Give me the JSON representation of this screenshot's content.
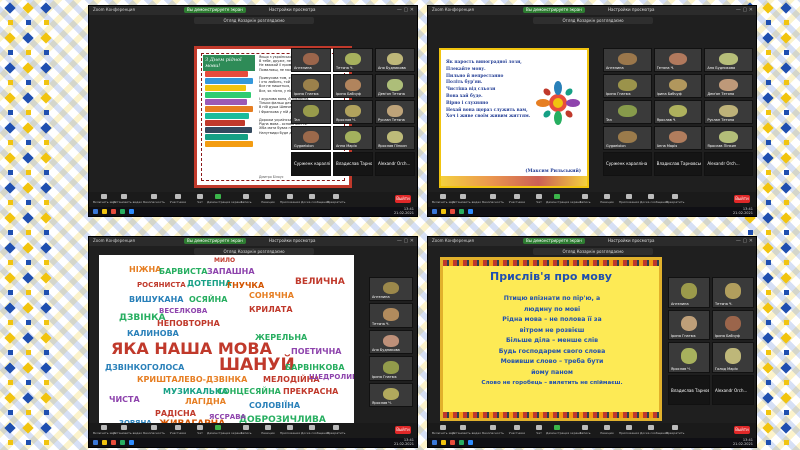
{
  "panels": [
    {
      "app_title": "Zoom Конференция",
      "meeting_pill": "Вы демонстрируете экран",
      "view_options": "Настройки просмотра",
      "share_bar": "Огляд Козаркін розглядаємо",
      "clock": {
        "time": "13:41",
        "date": "21.02.2021"
      },
      "gallery": [
        {
          "name": "Ангелина"
        },
        {
          "name": "Тетяна Ч."
        },
        {
          "name": "Аня Будникова"
        },
        {
          "name": "Ірина Гнатюк"
        },
        {
          "name": "Ірина Бабчуф"
        },
        {
          "name": "Дем'ян Тетяна"
        },
        {
          "name": "Tan"
        },
        {
          "name": "Ярослав Ч."
        },
        {
          "name": "Руслан Тетяна"
        },
        {
          "name": "Gygaelolon"
        },
        {
          "name": "Анна Марія"
        },
        {
          "name": "Ярослав Піпкин"
        },
        {
          "name": "Сурженк каралліна",
          "dark": true
        },
        {
          "name": "Владислав Тарновськ",
          "dark": true
        },
        {
          "name": "Alexandr Orch...",
          "dark": true
        }
      ],
      "toolbar": [
        "Включить звук",
        "Остановить видео",
        "Безопасность",
        "Участники",
        "Чат",
        "Демонстрация экрана",
        "Запись",
        "Реакции",
        "Приложения",
        "Доска сообщений",
        "Прекратить"
      ],
      "end_label": "Выйти",
      "slide": {
        "title": "З Днем рідної мови!",
        "poem": "Якщо з українською мовою\nВ тебе, друже, не все гаразд,\nНе вважай її примхою,\nПомиляєш, не молю все.\n\nПримусова тим, хто цурається,\nЇ хто любить, той легко вчить:\nВсе не пишеться, в ній вимовляється,\nВсе, як пісня, у ній звучить.\n\nІ журлива вона, й ніжнесна,\nТільки фальш для неї чужа.\nВ ній душа Шевченкова й Лесина,\nІ Франкова у ній душа.\n\nДорожи українською мовою,\nРідна мова - основа життя.\nХіба мати буває примусовою?\nНапутвиди буде дитя!",
        "author": "Дмитро Білоус"
      }
    },
    {
      "app_title": "Zoom Конференция",
      "meeting_pill": "Вы демонстрируете экран",
      "view_options": "Настройки просмотра",
      "share_bar": "Огляд Козаркін розглядаємо",
      "clock": {
        "time": "13:41",
        "date": "21.02.2021"
      },
      "gallery": [
        {
          "name": "Ангелина"
        },
        {
          "name": "Тетяна Ч."
        },
        {
          "name": "Аня Будникова"
        },
        {
          "name": "Ірина Гнатюк"
        },
        {
          "name": "Ірина Бабчуф"
        },
        {
          "name": "Дем'ян Тетяна"
        },
        {
          "name": "Tan"
        },
        {
          "name": "Ярослав Ч."
        },
        {
          "name": "Руслан Тетяна"
        },
        {
          "name": "Gygaelolon"
        },
        {
          "name": "Анна Марія"
        },
        {
          "name": "Ярослав Піпкин"
        },
        {
          "name": "Сурженк каралліна",
          "dark": true
        },
        {
          "name": "Владислав Тарновськ",
          "dark": true
        },
        {
          "name": "Alexandr Orch...",
          "dark": true
        }
      ],
      "toolbar": [
        "Включить звук",
        "Остановить видео",
        "Безопасность",
        "Участники",
        "Чат",
        "Демонстрация экрана",
        "Запись",
        "Реакции",
        "Приложения",
        "Доска сообщений",
        "Прекратить"
      ],
      "end_label": "Выйти",
      "slide": {
        "poem": "Як парость виноградної лози,\nПлекайте мову.\nПильно й непрестанно\nПоліть бур'ян.\nЧистіша від сльози\nВона хай буде.\nВірно і слухняно\nНехай вона щораз служить вам,\nХоч і живе своїм живим життям.",
        "author": "(Максим Рильський)"
      }
    },
    {
      "app_title": "Zoom Конференция",
      "meeting_pill": "Вы демонстрируете экран",
      "view_options": "Настройки просмотра",
      "share_bar": "Огляд Козаркін розглядаємо",
      "clock": {
        "time": "13:41",
        "date": "21.02.2021"
      },
      "gallery": [
        {
          "name": "Ангелина"
        },
        {
          "name": "Тетяна Ч."
        },
        {
          "name": "Аня Будникова"
        },
        {
          "name": "Ірина Гнатюк"
        },
        {
          "name": "Ярослав Ч."
        }
      ],
      "toolbar": [
        "Включить звук",
        "Остановить видео",
        "Безопасность",
        "Участники",
        "Чат",
        "Демонстрация экрана",
        "Запись",
        "Реакции",
        "Приложения",
        "Доска сообщений",
        "Прекратить"
      ],
      "end_label": "Выйти",
      "slide": {
        "words": [
          {
            "t": "МИЛО",
            "c": "#c0392b"
          },
          {
            "t": "НІЖНА",
            "c": "#e67e22"
          },
          {
            "t": "БАРВИСТА",
            "c": "#27ae60"
          },
          {
            "t": "ЗАПАШНА",
            "c": "#8e44ad"
          },
          {
            "t": "РОСЯНИСТА",
            "c": "#c0392b"
          },
          {
            "t": "ДОТЕПНА",
            "c": "#16a085"
          },
          {
            "t": "ГНУЧКА",
            "c": "#d35400"
          },
          {
            "t": "ВЕЛИЧНА",
            "c": "#c0392b"
          },
          {
            "t": "ВИШУКАНА",
            "c": "#2980b9"
          },
          {
            "t": "ОСЯЙНА",
            "c": "#27ae60"
          },
          {
            "t": "СОНЯЧНА",
            "c": "#e67e22"
          },
          {
            "t": "ВЕСЕЛКОВА",
            "c": "#8e44ad"
          },
          {
            "t": "КРИЛАТА",
            "c": "#c0392b"
          },
          {
            "t": "ДЗВІНКА",
            "c": "#27ae60"
          },
          {
            "t": "НЕПОВТОРНА",
            "c": "#c0392b"
          },
          {
            "t": "КАЛИНОВА",
            "c": "#2980b9"
          },
          {
            "t": "ЯКА НАША МОВА",
            "c": "#c0392b"
          },
          {
            "t": "ЖЕРЕЛЬНА",
            "c": "#27ae60"
          },
          {
            "t": "ШАНУЙ",
            "c": "#c0392b"
          },
          {
            "t": "ПОЕТИЧНА",
            "c": "#8e44ad"
          },
          {
            "t": "ДЗВІНКОГОЛОСА",
            "c": "#2980b9"
          },
          {
            "t": "БАРВІНКОВА",
            "c": "#27ae60"
          },
          {
            "t": "КРИШТАЛЕВО-ДЗВІНКА",
            "c": "#e67e22"
          },
          {
            "t": "МЕЛОДІЙНА",
            "c": "#c0392b"
          },
          {
            "t": "ЩЕДРОЛИВА",
            "c": "#8e44ad"
          },
          {
            "t": "МУЗИКАЛЬНА",
            "c": "#16a085"
          },
          {
            "t": "СОНЦЕСЯЙНА",
            "c": "#27ae60"
          },
          {
            "t": "ПРЕКРАСНА",
            "c": "#c0392b"
          },
          {
            "t": "СОЛОВІЇНА",
            "c": "#2980b9"
          },
          {
            "t": "ЛАГІДНА",
            "c": "#e67e22"
          },
          {
            "t": "ЧИСТА",
            "c": "#8e44ad"
          },
          {
            "t": "РАДІСНА",
            "c": "#c0392b"
          },
          {
            "t": "ЖИВАГАРНА",
            "c": "#d35400"
          },
          {
            "t": "ДОБРОЗИЧЛИВА",
            "c": "#27ae60"
          },
          {
            "t": "ЗОРЯНА",
            "c": "#2980b9"
          },
          {
            "t": "ЯССРАВА",
            "c": "#8e44ad"
          }
        ]
      }
    },
    {
      "app_title": "Zoom Конференция",
      "meeting_pill": "Вы демонстрируете экран",
      "view_options": "Настройки просмотра",
      "share_bar": "Огляд Козаркін розглядаємо",
      "clock": {
        "time": "13:41",
        "date": "21.02.2021"
      },
      "gallery": [
        {
          "name": "Ангелина"
        },
        {
          "name": "Тетяна Ч."
        },
        {
          "name": "Ірина Гнатюк"
        },
        {
          "name": "Ірина Бабчуф"
        },
        {
          "name": "Ярослав Ч."
        },
        {
          "name": "Голод Марія"
        },
        {
          "name": "Владислав Тарновськ",
          "dark": true
        },
        {
          "name": "Alexandr Orch...",
          "dark": true
        }
      ],
      "toolbar": [
        "Включить звук",
        "Остановить видео",
        "Безопасность",
        "Участники",
        "Чат",
        "Демонстрация экрана",
        "Запись",
        "Реакции",
        "Приложения",
        "Доска сообщений",
        "Прекратить"
      ],
      "end_label": "Выйти",
      "slide": {
        "title": "Прислів'я про мову",
        "lines": [
          "Птицю впізнати по пір'ю, а",
          "людину по мові",
          "Рідна мова – не полова її за",
          "вітром не розвієш",
          "Більше діла – менше слів",
          "Будь господарем свого слова",
          "Мовивши слово – треба бути",
          "йому паном",
          "Слово не горобець – вилетить не спіймаєш."
        ]
      }
    }
  ]
}
